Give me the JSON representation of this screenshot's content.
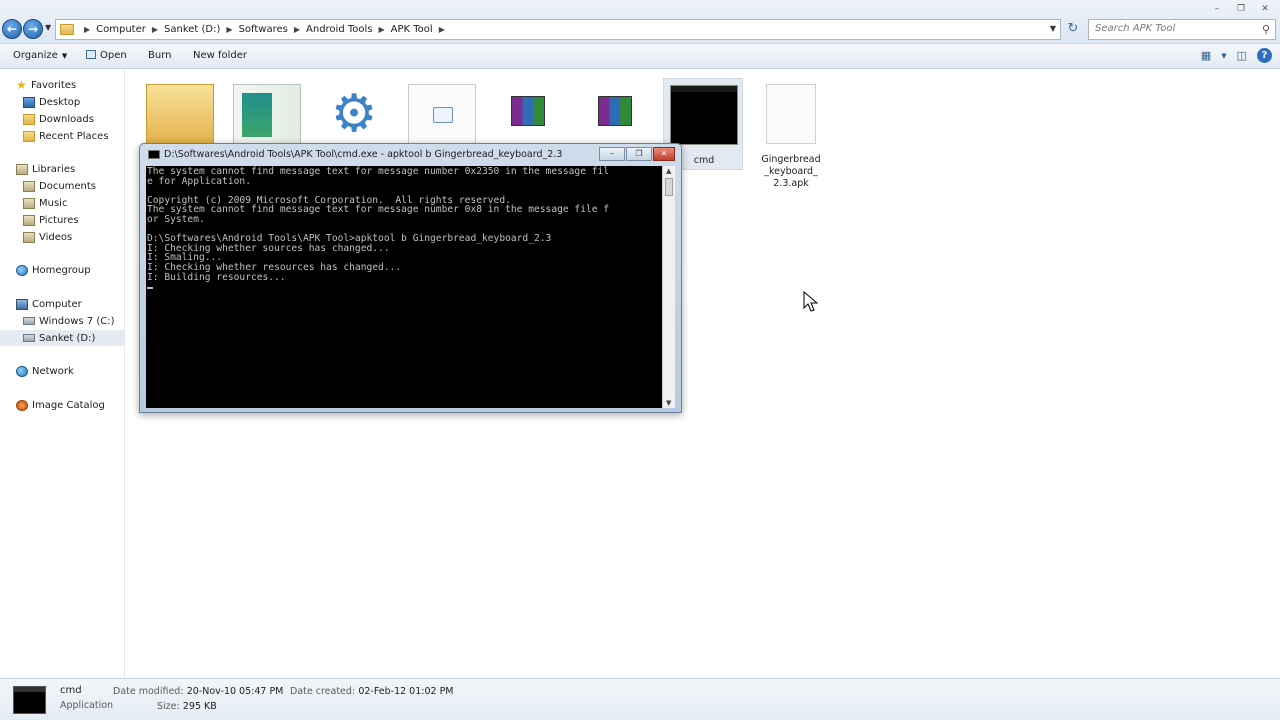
{
  "address": {
    "crumbs": [
      "Computer",
      "Sanket (D:)",
      "Softwares",
      "Android Tools",
      "APK Tool"
    ],
    "search_placeholder": "Search APK Tool"
  },
  "toolbar": {
    "organize": "Organize",
    "open": "Open",
    "burn": "Burn",
    "new_folder": "New folder"
  },
  "nav": {
    "favorites": "Favorites",
    "desktop": "Desktop",
    "downloads": "Downloads",
    "recent_places": "Recent Places",
    "libraries": "Libraries",
    "documents": "Documents",
    "music": "Music",
    "pictures": "Pictures",
    "videos": "Videos",
    "homegroup": "Homegroup",
    "computer": "Computer",
    "drive_c": "Windows 7 (C:)",
    "drive_d": "Sanket (D:)",
    "network": "Network",
    "image_catalog": "Image Catalog"
  },
  "files": {
    "cmd": "cmd",
    "apk": "Gingerbread_keyboard_2.3.apk"
  },
  "cmd_window": {
    "title": "D:\\Softwares\\Android Tools\\APK Tool\\cmd.exe - apktool  b Gingerbread_keyboard_2.3",
    "output": "The system cannot find message text for message number 0x2350 in the message fil\ne for Application.\n\nCopyright (c) 2009 Microsoft Corporation.  All rights reserved.\nThe system cannot find message text for message number 0x8 in the message file f\nor System.\n\nD:\\Softwares\\Android Tools\\APK Tool>apktool b Gingerbread_keyboard_2.3\nI: Checking whether sources has changed...\nI: Smaling...\nI: Checking whether resources has changed...\nI: Building resources...\n"
  },
  "details": {
    "name": "cmd",
    "type": "Application",
    "modified_label": "Date modified:",
    "modified_value": "20-Nov-10 05:47 PM",
    "created_label": "Date created:",
    "created_value": "02-Feb-12 01:02 PM",
    "size_label": "Size:",
    "size_value": "295 KB"
  }
}
